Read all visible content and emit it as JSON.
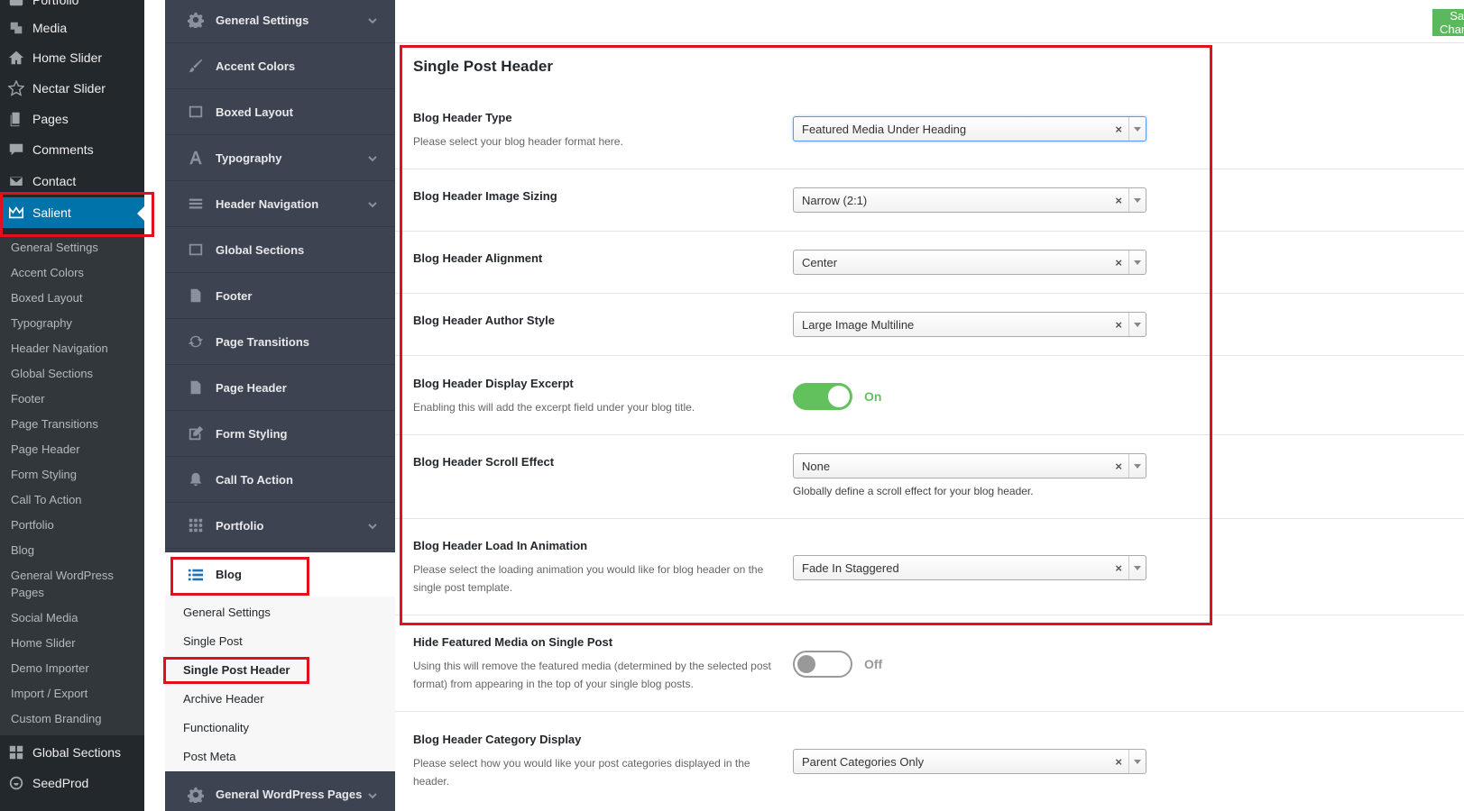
{
  "wp_menu": {
    "items": [
      {
        "label": "Portfolio",
        "icon": "portfolio-icon"
      },
      {
        "label": "Media",
        "icon": "media-icon"
      },
      {
        "label": "Home Slider",
        "icon": "home-icon"
      },
      {
        "label": "Nectar Slider",
        "icon": "star-icon"
      },
      {
        "label": "Pages",
        "icon": "pages-icon"
      },
      {
        "label": "Comments",
        "icon": "comments-icon"
      },
      {
        "label": "Contact",
        "icon": "mail-icon"
      },
      {
        "label": "Salient",
        "icon": "crown-icon"
      }
    ],
    "submenu": [
      "General Settings",
      "Accent Colors",
      "Boxed Layout",
      "Typography",
      "Header Navigation",
      "Global Sections",
      "Footer",
      "Page Transitions",
      "Page Header",
      "Form Styling",
      "Call To Action",
      "Portfolio",
      "Blog",
      "General WordPress Pages",
      "Social Media",
      "Home Slider",
      "Demo Importer",
      "Import / Export",
      "Custom Branding"
    ],
    "bottom_items": [
      {
        "label": "Global Sections",
        "icon": "grid-icon"
      },
      {
        "label": "SeedProd",
        "icon": "seedprod-icon"
      }
    ]
  },
  "panel_nav": {
    "items": [
      {
        "label": "General Settings",
        "icon": "gear-icon",
        "expandable": true
      },
      {
        "label": "Accent Colors",
        "icon": "brush-icon",
        "expandable": false
      },
      {
        "label": "Boxed Layout",
        "icon": "boxed-icon",
        "expandable": false
      },
      {
        "label": "Typography",
        "icon": "typography-icon",
        "expandable": true
      },
      {
        "label": "Header Navigation",
        "icon": "menu-icon",
        "expandable": true
      },
      {
        "label": "Global Sections",
        "icon": "boxed-icon",
        "expandable": false
      },
      {
        "label": "Footer",
        "icon": "file-icon",
        "expandable": false
      },
      {
        "label": "Page Transitions",
        "icon": "refresh-icon",
        "expandable": false
      },
      {
        "label": "Page Header",
        "icon": "file-icon",
        "expandable": false
      },
      {
        "label": "Form Styling",
        "icon": "edit-icon",
        "expandable": false
      },
      {
        "label": "Call To Action",
        "icon": "bell-icon",
        "expandable": false
      },
      {
        "label": "Portfolio",
        "icon": "grid-icon",
        "expandable": true
      }
    ],
    "blog": {
      "label": "Blog",
      "icon": "list-icon",
      "subitems": [
        "General Settings",
        "Single Post",
        "Single Post Header",
        "Archive Header",
        "Functionality",
        "Post Meta"
      ]
    },
    "bottom_item": {
      "label": "General WordPress Pages",
      "icon": "gear-icon"
    }
  },
  "toolbar": {
    "save_label": "Save Changes"
  },
  "section": {
    "title": "Single Post Header",
    "fields": [
      {
        "label": "Blog Header Type",
        "desc": "Please select your blog header format here.",
        "value": "Featured Media Under Heading"
      },
      {
        "label": "Blog Header Image Sizing",
        "value": "Narrow (2:1)"
      },
      {
        "label": "Blog Header Alignment",
        "value": "Center"
      },
      {
        "label": "Blog Header Author Style",
        "value": "Large Image Multiline"
      },
      {
        "label": "Blog Header Display Excerpt",
        "desc": "Enabling this will add the excerpt field under your blog title.",
        "toggle": "On"
      },
      {
        "label": "Blog Header Scroll Effect",
        "value": "None",
        "field_desc": "Globally define a scroll effect for your blog header."
      },
      {
        "label": "Blog Header Load In Animation",
        "desc": "Please select the loading animation you would like for blog header on the single post template.",
        "value": "Fade In Staggered"
      },
      {
        "label": "Hide Featured Media on Single Post",
        "desc": "Using this will remove the featured media (determined by the selected post format) from appearing in the top of your single blog posts.",
        "toggle": "Off"
      },
      {
        "label": "Blog Header Category Display",
        "desc": "Please select how you would like your post categories displayed in the header.",
        "value": "Parent Categories Only"
      }
    ]
  },
  "colors": {
    "accent": "#0073aa",
    "toggle_on": "#63c15d",
    "annotation": "#e0101c"
  }
}
